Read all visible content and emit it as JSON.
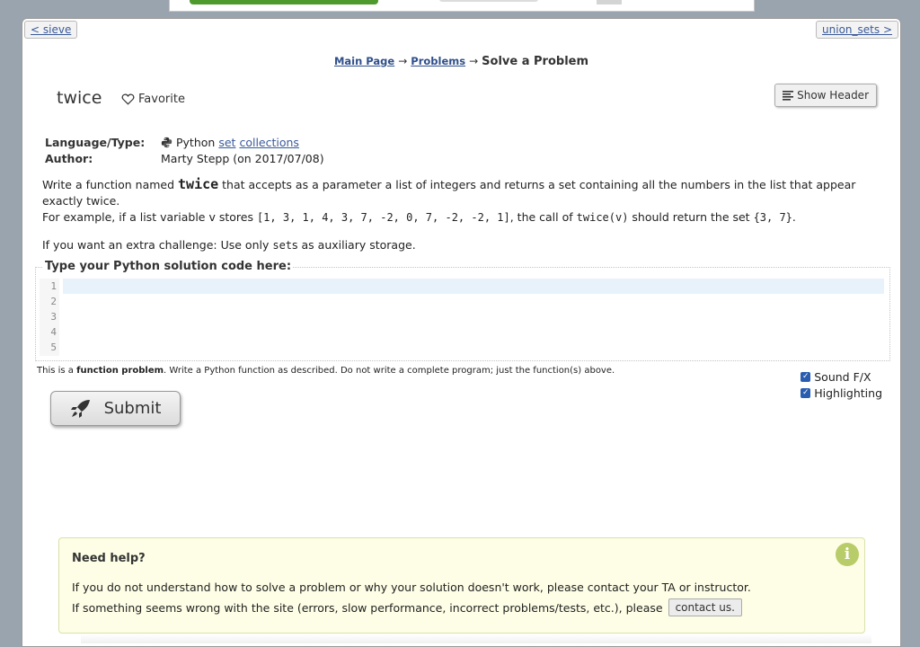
{
  "nav": {
    "prev": "< sieve",
    "next": "union_sets >"
  },
  "breadcrumb": {
    "main": "Main Page",
    "problems": "Problems",
    "current": "Solve a Problem",
    "sep": "→"
  },
  "problem": {
    "title": "twice",
    "favorite_label": "Favorite",
    "show_header_label": "Show Header"
  },
  "meta": {
    "language_label": "Language/Type:",
    "language": "Python",
    "tag1": "set",
    "tag2": "collections",
    "author_label": "Author:",
    "author": "Marty Stepp (on 2017/07/08)"
  },
  "description": {
    "p1_a": "Write a function named ",
    "p1_code": "twice",
    "p1_b": " that accepts as a parameter a list of integers and returns a set containing all the numbers in the list that appear exactly twice.",
    "p1_c": "For example, if a list variable v stores ",
    "p1_list": "[1, 3, 1, 4, 3, 7, -2, 0, 7, -2, -2, 1]",
    "p1_d": ", the call of ",
    "p1_call": "twice(v)",
    "p1_e": " should return the set ",
    "p1_set": "{3, 7}",
    "p1_f": ".",
    "p2_a": "If you want an extra challenge: Use only ",
    "p2_code": "set",
    "p2_b": "s as auxiliary storage."
  },
  "editor": {
    "legend": "Type your Python solution code here:",
    "line_numbers": [
      "1",
      "2",
      "3",
      "4",
      "5"
    ]
  },
  "hint": {
    "a": "This is a ",
    "bold": "function problem",
    "b": ". Write a Python function as described. Do not write a complete program; just the function(s) above."
  },
  "options": {
    "sound": "Sound F/X",
    "highlighting": "Highlighting"
  },
  "submit_label": "Submit",
  "help": {
    "title": "Need help?",
    "line1": "If you do not understand how to solve a problem or why your solution doesn't work, please contact your TA or instructor.",
    "line2": "If something seems wrong with the site (errors, slow performance, incorrect problems/tests, etc.), please",
    "contact_label": "contact us."
  }
}
